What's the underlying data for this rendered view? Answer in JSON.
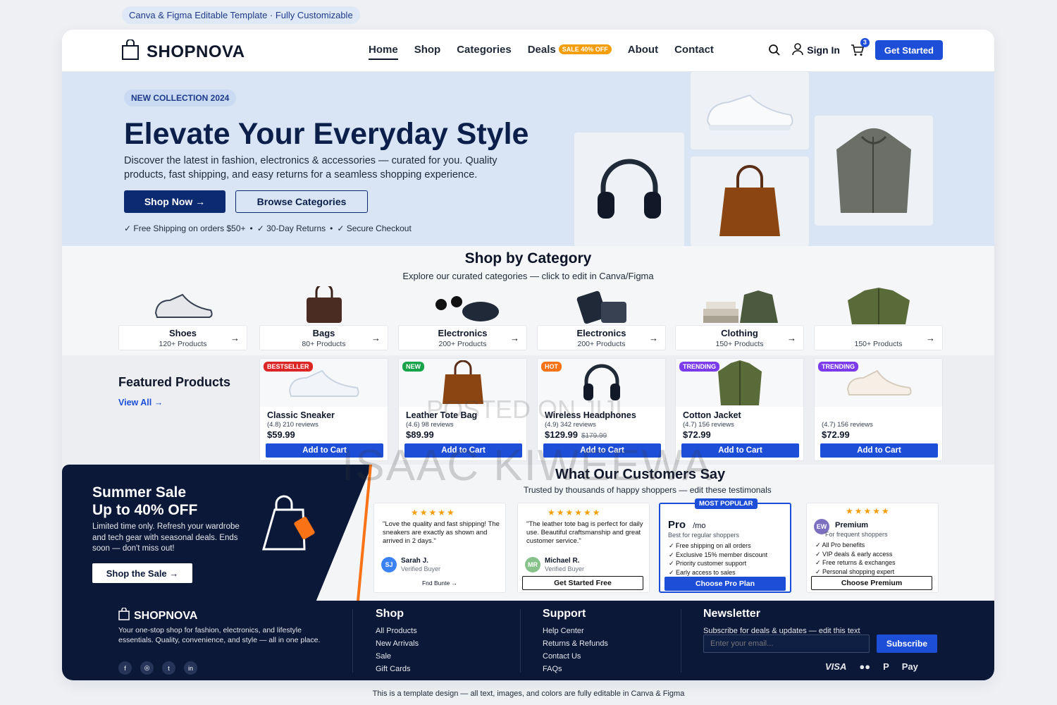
{
  "top_pill": "Canva & Figma Editable Template · Fully Customizable",
  "nav": {
    "brand": "SHOPNOVA",
    "menu": [
      "Home",
      "Shop",
      "Categories",
      "Deals",
      "About",
      "Contact"
    ],
    "deal_badge": "SALE 40% OFF",
    "sign_in": "Sign In",
    "cart_count": "3",
    "cta": "Get Started"
  },
  "hero": {
    "badge": "NEW COLLECTION 2024",
    "title": "Elevate Your Everyday Style",
    "description": "Discover the latest in fashion, electronics & accessories — curated for you. Quality products, fast shipping, and easy returns for a seamless shopping experience.",
    "primary_btn": "Shop Now →",
    "secondary_btn": "Browse Categories",
    "perks": [
      "✓ Free Shipping on orders $50+",
      "•",
      "✓ 30-Day Returns",
      "•",
      "✓ Secure Checkout"
    ]
  },
  "categories": {
    "title": "Shop by Category",
    "subtitle": "Explore our curated categories — click to edit in Canva/Figma",
    "items": [
      {
        "name": "Shoes",
        "count": "120+ Products"
      },
      {
        "name": "Bags",
        "count": "80+ Products"
      },
      {
        "name": "Electronics",
        "count": "200+ Products"
      },
      {
        "name": "Electronics",
        "count": "200+ Products"
      },
      {
        "name": "Clothing",
        "count": "150+ Products"
      },
      {
        "name": "",
        "count": "150+ Products"
      }
    ]
  },
  "featured": {
    "title": "Featured Products",
    "view_all": "View All →",
    "products": [
      {
        "badge": "BESTSELLER",
        "badge_color": "#dc2626",
        "name": "Classic Sneaker",
        "rating": "(4.8) 210 reviews",
        "price": "$59.99",
        "old_price": "",
        "button": "Add to Cart"
      },
      {
        "badge": "NEW",
        "badge_color": "#16a34a",
        "name": "Leather Tote Bag",
        "rating": "(4.6) 98 reviews",
        "price": "$89.99",
        "old_price": "",
        "button": "Add to Cart"
      },
      {
        "badge": "HOT",
        "badge_color": "#f97316",
        "name": "Wireless Headphones",
        "rating": "(4.9) 342 reviews",
        "price": "$129.99",
        "old_price": "$179.99",
        "button": "Add to Cart"
      },
      {
        "badge": "TRENDING",
        "badge_color": "#7c3aed",
        "name": "Cotton Jacket",
        "rating": "(4.7) 156 reviews",
        "price": "$72.99",
        "old_price": "",
        "button": "Add to Cart"
      },
      {
        "badge": "TRENDING",
        "badge_color": "#7c3aed",
        "name": "",
        "rating": "(4.7) 156 reviews",
        "price": "$72.99",
        "old_price": "",
        "button": "Add to Cart"
      }
    ]
  },
  "sale": {
    "title_line1": "Summer Sale",
    "title_line2": "Up to 40% OFF",
    "description": "Limited time only. Refresh your wardrobe and tech gear with seasonal deals. Ends soon — don't miss out!",
    "button": "Shop the Sale →"
  },
  "testimonials": {
    "title": "What Our Customers Say",
    "subtitle": "Trusted by thousands of happy shoppers — edit these testimonals",
    "reviews": [
      {
        "stars": "★★★★★",
        "quote": "\"Love the quality and fast shipping! The sneakers are exactly as shown and arrived in 2 days.\"",
        "initials": "SJ",
        "name": "Sarah J.",
        "role": "Verified Buyer",
        "link": "Fnd Bunte →"
      },
      {
        "stars": "★★★★★★",
        "quote": "\"The leather tote bag is perfect for daily use. Beautiful craftsmanship and great customer service.\"",
        "initials": "MR",
        "name": "Michael R.",
        "role": "Verified Buyer",
        "button": "Get Started Free"
      }
    ],
    "pro": {
      "popular": "MOST POPULAR",
      "title": "Pro",
      "per": "/mo",
      "sub": "Best for regular shoppers",
      "features": [
        "✓  Free shipping on all orders",
        "✓  Exclusive 15% member discount",
        "✓  Priority customer support",
        "✓  Early access to sales"
      ],
      "button": "Choose Pro Plan"
    },
    "premium": {
      "stars": "★★★★★",
      "initials": "EW",
      "title": "Premium",
      "sub": "For frequent shoppers",
      "features": [
        "✓  All Pro benefits",
        "✓  VIP deals & early access",
        "✓  Free returns & exchanges",
        "✓  Personal shopping expert"
      ],
      "button": "Choose Premium"
    }
  },
  "footer": {
    "brand": "SHOPNOVA",
    "description": "Your one-stop shop for fashion, electronics, and lifestyle essentials. Quality, convenience, and style — all in one place.",
    "socials": [
      "f",
      "◎",
      "t",
      "in"
    ],
    "shop": {
      "title": "Shop",
      "links": [
        "All Products",
        "New Arrivals",
        "Sale",
        "Gift Cards"
      ]
    },
    "support": {
      "title": "Support",
      "links": [
        "Help Center",
        "Returns & Refunds",
        "Contact Us",
        "FAQs"
      ]
    },
    "newsletter": {
      "title": "Newsletter",
      "subtitle": "Subscribe for deals & updates — edit this text",
      "placeholder": "Enter your email...",
      "button": "Subscribe"
    },
    "payments": [
      "VISA",
      "●●",
      "P",
      "Pay"
    ]
  },
  "disclaimer": "This is a template design — all text, images, and colors are fully editable in Canva & Figma",
  "watermark": "ISAAC KIWEEWA",
  "watermark_small": "POSTED ON JIJI"
}
